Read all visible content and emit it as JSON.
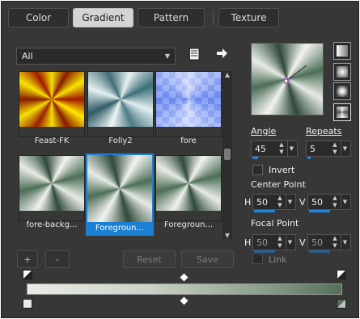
{
  "tabs": [
    "Color",
    "Gradient",
    "Pattern",
    "Texture"
  ],
  "active_tab": "Gradient",
  "category": {
    "selected": "All"
  },
  "gradients": [
    {
      "name": "Feast-FK",
      "style": "feast"
    },
    {
      "name": "Folly2",
      "style": "folly"
    },
    {
      "name": "fore",
      "style": "fore"
    },
    {
      "name": "fore-backg...",
      "style": "green"
    },
    {
      "name": "Foregroun...",
      "style": "green",
      "selected": true
    },
    {
      "name": "Foregroun...",
      "style": "green"
    }
  ],
  "buttons": {
    "add": "+",
    "remove": "-",
    "reset": "Reset",
    "save": "Save"
  },
  "angle": {
    "label": "Angle",
    "value": "45",
    "fraction": 0.13
  },
  "repeats": {
    "label": "Repeats",
    "value": "5",
    "fraction": 0.05
  },
  "invert": {
    "label": "Invert",
    "checked": false
  },
  "center_point": {
    "label": "Center Point",
    "h_label": "H",
    "h": "50",
    "v_label": "V",
    "v": "50"
  },
  "focal_point": {
    "label": "Focal Point",
    "h_label": "H",
    "h": "50",
    "v_label": "V",
    "v": "50"
  },
  "link": {
    "label": "Link",
    "checked": false
  },
  "colors": {
    "accent": "#1b7fd3",
    "background": "#373737"
  },
  "icons": {
    "library": "library-icon",
    "arrow": "arrow-right-icon"
  }
}
